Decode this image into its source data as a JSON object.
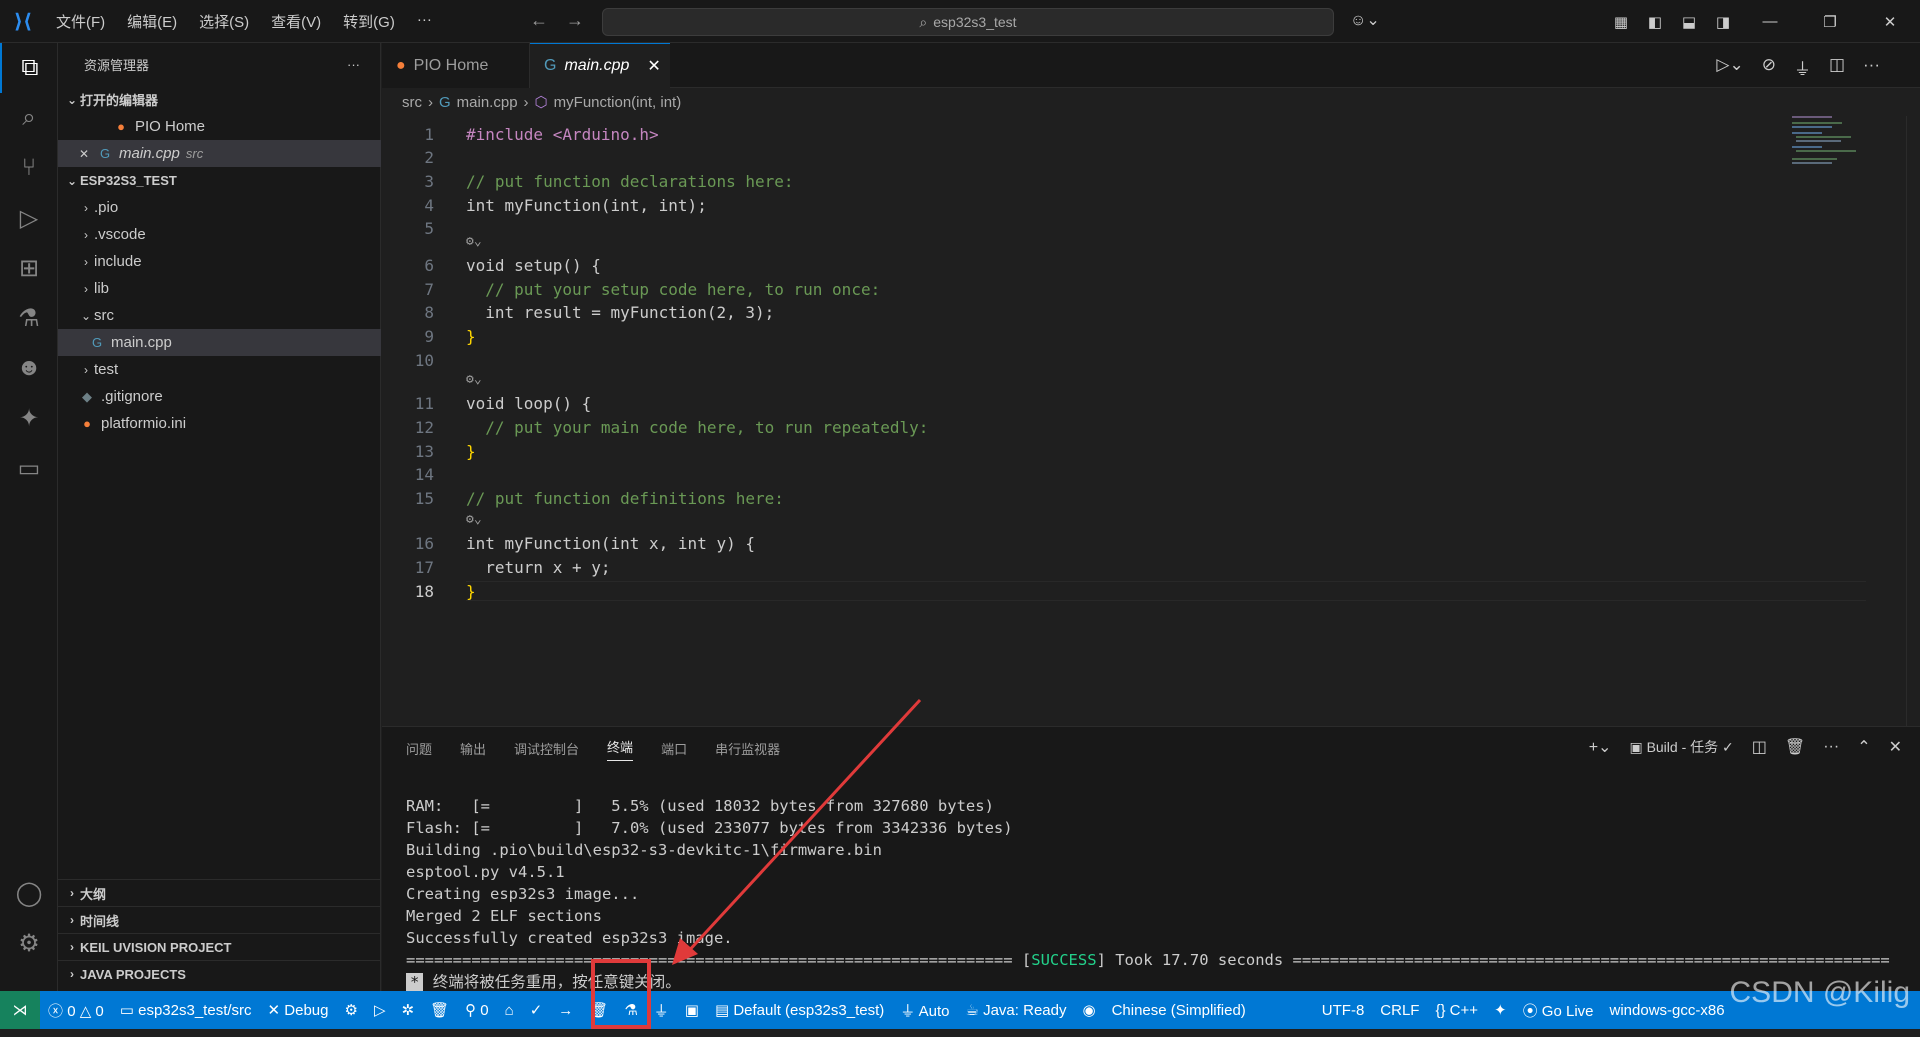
{
  "titlebar": {
    "menu": [
      "文件(F)",
      "编辑(E)",
      "选择(S)",
      "查看(V)",
      "转到(G)",
      "···"
    ],
    "search": "esp32s3_test"
  },
  "sidebar": {
    "title": "资源管理器",
    "open_editors_header": "打开的编辑器",
    "open_editors": [
      {
        "name": "PIO Home",
        "path": ""
      },
      {
        "name": "main.cpp",
        "path": "src"
      }
    ],
    "project_header": "ESP32S3_TEST",
    "tree": [
      ".pio",
      ".vscode",
      "include",
      "lib",
      "src",
      "main.cpp",
      "test",
      ".gitignore",
      "platformio.ini"
    ],
    "bottom_sections": [
      "大纲",
      "时间线",
      "KEIL UVISION PROJECT",
      "JAVA PROJECTS"
    ]
  },
  "tabs": [
    {
      "label": "PIO Home"
    },
    {
      "label": "main.cpp"
    }
  ],
  "breadcrumb": [
    "src",
    "main.cpp",
    "myFunction(int, int)"
  ],
  "editor": {
    "line_numbers": [
      "1",
      "2",
      "3",
      "4",
      "5",
      "6",
      "7",
      "8",
      "9",
      "10",
      "11",
      "12",
      "13",
      "14",
      "15",
      "16",
      "17",
      "18"
    ],
    "lines": [
      "#include <Arduino.h>",
      "",
      "// put function declarations here:",
      "int myFunction(int, int);",
      "",
      "void setup() {",
      "  // put your setup code here, to run once:",
      "  int result = myFunction(2, 3);",
      "}",
      "",
      "void loop() {",
      "  // put your main code here, to run repeatedly:",
      "}",
      "",
      "// put function definitions here:",
      "int myFunction(int x, int y) {",
      "  return x + y;",
      "}"
    ]
  },
  "panel": {
    "tabs": [
      "问题",
      "输出",
      "调试控制台",
      "终端",
      "端口",
      "串行监视器"
    ],
    "active_tab": "终端",
    "task": "Build - 任务",
    "terminal": [
      "RAM:   [=         ]   5.5% (used 18032 bytes from 327680 bytes)",
      "Flash: [=         ]   7.0% (used 233077 bytes from 3342336 bytes)",
      "Building .pio\\build\\esp32-s3-devkitc-1\\firmware.bin",
      "esptool.py v4.5.1",
      "Creating esp32s3 image...",
      "Merged 2 ELF sections",
      "Successfully created esp32s3 image."
    ],
    "success_left": "================================================================= [",
    "success_word": "SUCCESS",
    "success_right": "] Took 17.70 seconds ================================================================",
    "reuse_note": "终端将被任务重用，按任意键关闭。"
  },
  "statusbar": {
    "errors": "0",
    "warnings": "0",
    "folder": "esp32s3_test/src",
    "debug": "Debug",
    "ports": "0",
    "env": "Default (esp32s3_test)",
    "auto": "Auto",
    "java": "Java: Ready",
    "lang": "Chinese (Simplified)",
    "encoding": "UTF-8",
    "eol": "CRLF",
    "language_mode": "C++",
    "golive": "Go Live",
    "compiler": "windows-gcc-x86"
  },
  "watermark": "CSDN @Kilig",
  "annotation_color": "#e03a3a"
}
